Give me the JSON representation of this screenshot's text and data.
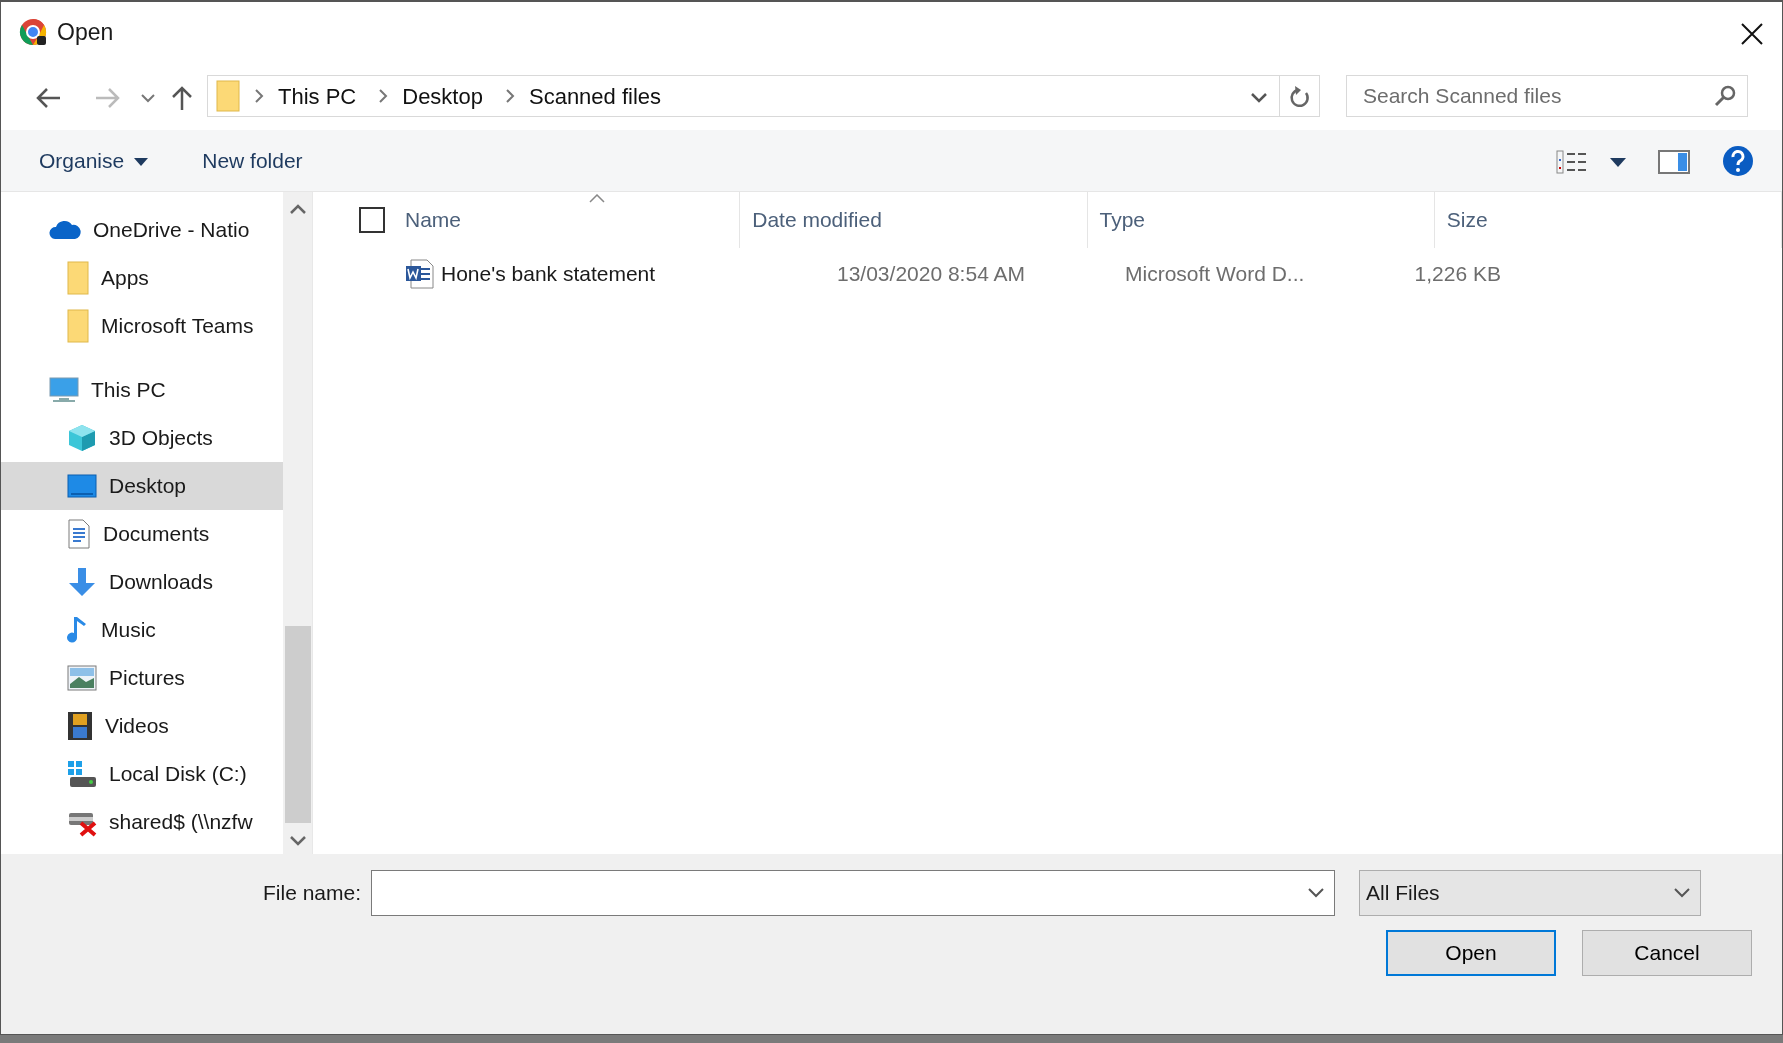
{
  "window": {
    "title": "Open"
  },
  "address": {
    "breadcrumbs": [
      "This PC",
      "Desktop",
      "Scanned files"
    ]
  },
  "search": {
    "placeholder": "Search Scanned files"
  },
  "toolbar": {
    "buttons": [
      {
        "label": "Organise",
        "kind": "menu"
      },
      {
        "label": "New folder",
        "kind": "plain"
      }
    ]
  },
  "sidebar": {
    "items": [
      {
        "label": "OneDrive - Natio",
        "kind": "cloud",
        "selected": false,
        "children": [
          {
            "label": "Apps",
            "kind": "folder",
            "selected": false
          },
          {
            "label": "Microsoft Teams",
            "kind": "folder",
            "selected": false
          }
        ]
      },
      {
        "label": "This PC",
        "kind": "pc",
        "selected": false,
        "children": [
          {
            "label": "3D Objects",
            "kind": "cube",
            "selected": false
          },
          {
            "label": "Desktop",
            "kind": "desktop",
            "selected": true
          },
          {
            "label": "Documents",
            "kind": "document",
            "selected": false
          },
          {
            "label": "Downloads",
            "kind": "download",
            "selected": false
          },
          {
            "label": "Music",
            "kind": "music",
            "selected": false
          },
          {
            "label": "Pictures",
            "kind": "pictures",
            "selected": false
          },
          {
            "label": "Videos",
            "kind": "video",
            "selected": false
          },
          {
            "label": "Local Disk (C:)",
            "kind": "disk",
            "selected": false
          },
          {
            "label": "shared$ (\\\\nzfw",
            "kind": "netdrive",
            "selected": false
          }
        ]
      }
    ]
  },
  "table": {
    "select_all": {
      "checked": false
    },
    "columns": [
      {
        "label": "Name",
        "sorted": true
      },
      {
        "label": "Date modified",
        "sorted": false
      },
      {
        "label": "Type",
        "sorted": false
      },
      {
        "label": "Size",
        "sorted": false
      }
    ],
    "rows": [
      {
        "name": "Hone's bank statement",
        "date": "13/03/2020 8:54 AM",
        "type": "Microsoft Word D...",
        "size": "1,226 KB",
        "selected": false
      }
    ]
  },
  "footer": {
    "file_name_label": "File name:",
    "file_type": "All Files",
    "buttons": [
      {
        "label": "Open",
        "default": true
      },
      {
        "label": "Cancel",
        "default": false
      }
    ]
  }
}
